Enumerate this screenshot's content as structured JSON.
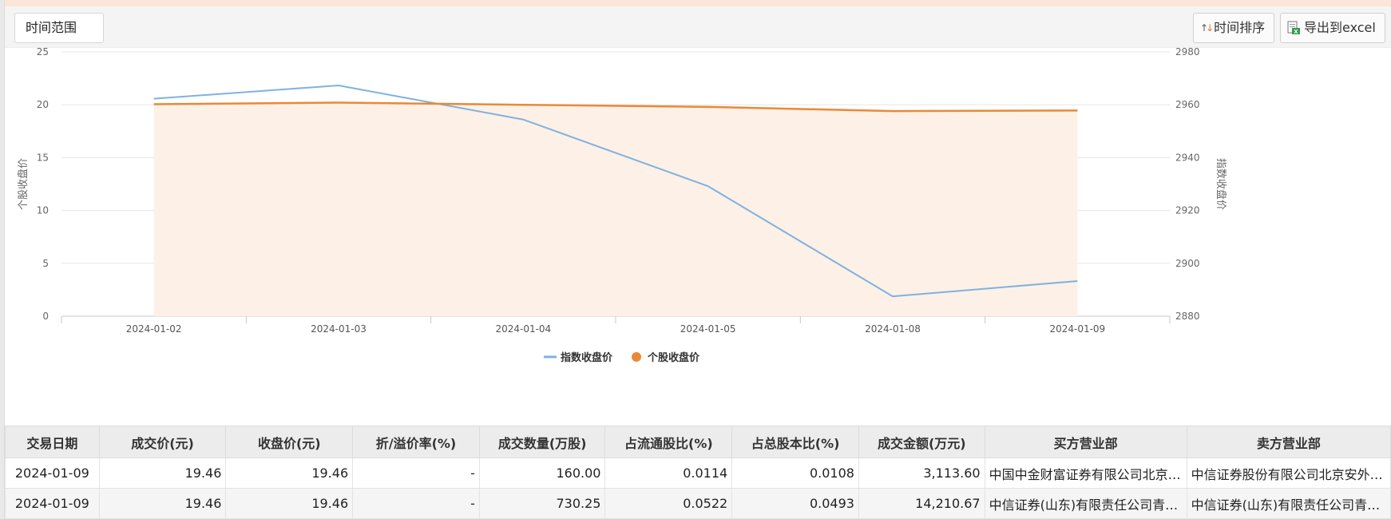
{
  "toolbar": {
    "range_label": "时间范围",
    "sort_label": "时间排序",
    "export_label": "导出到excel"
  },
  "chart_data": {
    "type": "line",
    "categories": [
      "2024-01-02",
      "2024-01-03",
      "2024-01-04",
      "2024-01-05",
      "2024-01-08",
      "2024-01-09"
    ],
    "series": [
      {
        "name": "指数收盘价",
        "axis": "right",
        "values": [
          2962.3,
          2967.3,
          2954.4,
          2929.2,
          2887.5,
          2893.3
        ],
        "color": "#7fb2df"
      },
      {
        "name": "个股收盘价",
        "axis": "left",
        "values": [
          20.05,
          20.2,
          20.0,
          19.8,
          19.4,
          19.46
        ],
        "color": "#e8893a",
        "fill": "#fdf0e6"
      }
    ],
    "yleft": {
      "label": "个股收盘价",
      "ticks": [
        "0",
        "5",
        "10",
        "15",
        "20",
        "25"
      ],
      "ylim": [
        0,
        25
      ]
    },
    "yright": {
      "label": "指数收盘价",
      "ticks": [
        "2880",
        "2900",
        "2920",
        "2940",
        "2960",
        "2980"
      ],
      "ylim": [
        2880,
        2980
      ]
    },
    "grid": true,
    "legend_position": "bottom-center"
  },
  "table": {
    "headers": [
      "交易日期",
      "成交价(元)",
      "收盘价(元)",
      "折/溢价率(%)",
      "成交数量(万股)",
      "占流通股比(%)",
      "占总股本比(%)",
      "成交金额(万元)",
      "买方营业部",
      "卖方营业部"
    ],
    "rows": [
      [
        "2024-01-09",
        "19.46",
        "19.46",
        "-",
        "160.00",
        "0.0114",
        "0.0108",
        "3,113.60",
        "中国中金财富证券有限公司北京宋庄路证券营业部",
        "中信证券股份有限公司北京安外大街证券营业部"
      ],
      [
        "2024-01-09",
        "19.46",
        "19.46",
        "-",
        "730.25",
        "0.0522",
        "0.0493",
        "14,210.67",
        "中信证券(山东)有限责任公司青岛分公司",
        "中信证券(山东)有限责任公司青岛分公司"
      ]
    ]
  }
}
